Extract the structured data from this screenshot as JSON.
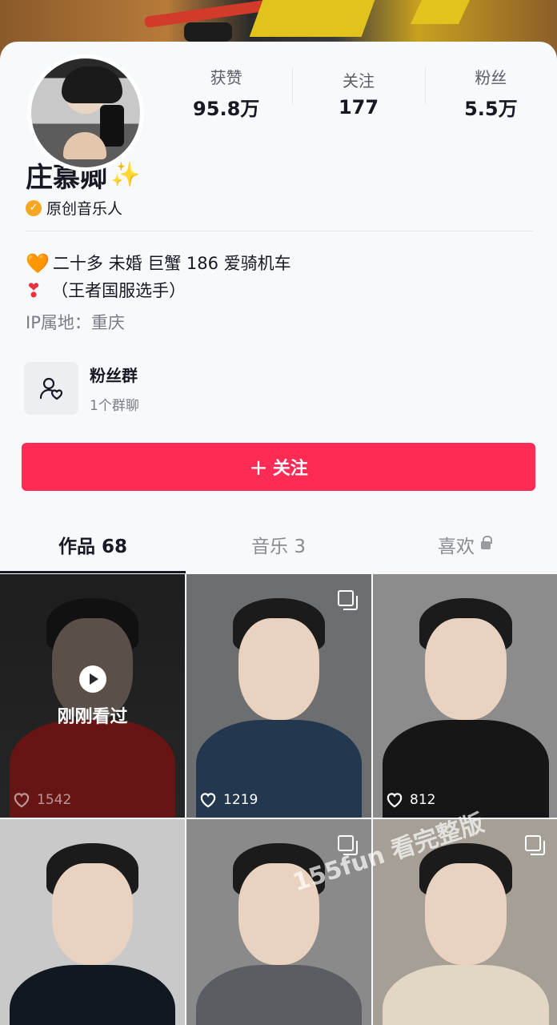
{
  "profile": {
    "name": "庄慕卿",
    "name_emoji": "✨",
    "verify_label": "原创音乐人",
    "stats": [
      {
        "label": "获赞",
        "value": "95.8万"
      },
      {
        "label": "关注",
        "value": "177"
      },
      {
        "label": "粉丝",
        "value": "5.5万"
      }
    ],
    "bio_line1_emoji": "🧡",
    "bio_line1": "二十多 未婚 巨蟹 186 爱骑机车",
    "bio_line2_emoji": "❣",
    "bio_line2": "（王者国服选手）",
    "ip_location": "IP属地：重庆"
  },
  "fan_group": {
    "title": "粉丝群",
    "subtitle": "1个群聊"
  },
  "follow_button": {
    "icon": "+",
    "label": "关注"
  },
  "tabs": [
    {
      "label": "作品 68"
    },
    {
      "label": "音乐 3"
    },
    {
      "label": "喜欢"
    }
  ],
  "videos": [
    {
      "likes": "1542",
      "recently_watched": "刚刚看过"
    },
    {
      "likes": "1219"
    },
    {
      "likes": "812"
    },
    {},
    {},
    {}
  ],
  "watermark": "155fun 看完整版",
  "colors": {
    "accent": "#fe2c55",
    "verify": "#f5a623",
    "text": "#161823"
  }
}
